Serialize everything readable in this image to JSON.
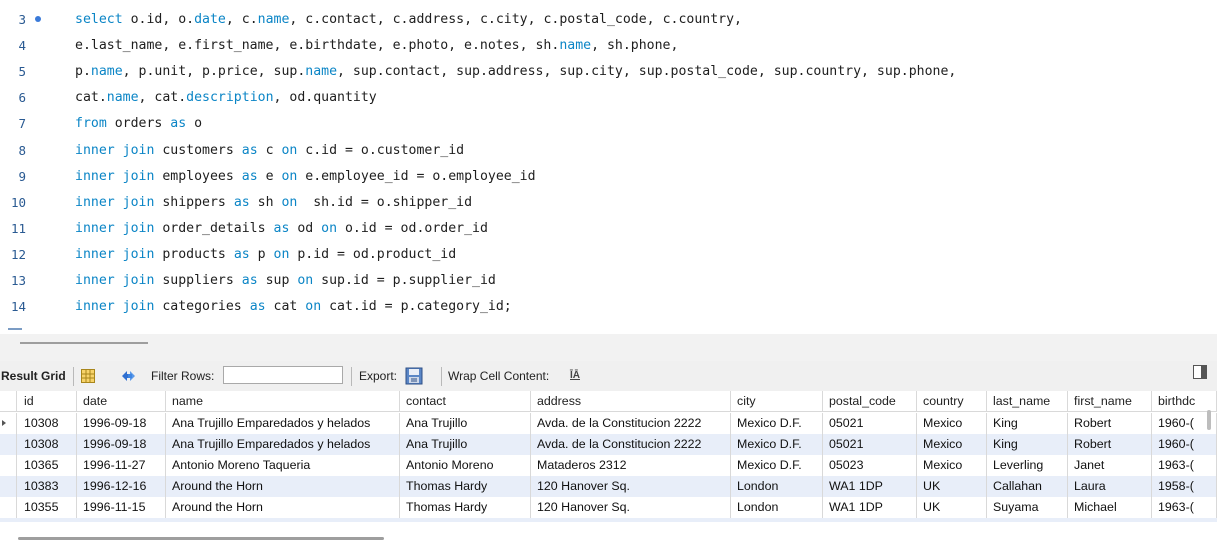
{
  "editor": {
    "lines": [
      {
        "num": "3",
        "has_dot": true,
        "tokens": [
          [
            "kw",
            "select "
          ],
          [
            "id",
            "o.id, o."
          ],
          [
            "kw",
            "date"
          ],
          [
            "id",
            ", c."
          ],
          [
            "kw",
            "name"
          ],
          [
            "id",
            ", c.contact, c.address, c.city, c.postal_code, c.country,"
          ]
        ]
      },
      {
        "num": "4",
        "has_dot": false,
        "tokens": [
          [
            "id",
            "e.last_name, e.first_name, e.birthdate, e.photo, e.notes, sh."
          ],
          [
            "kw",
            "name"
          ],
          [
            "id",
            ", sh.phone,"
          ]
        ]
      },
      {
        "num": "5",
        "has_dot": false,
        "tokens": [
          [
            "id",
            "p."
          ],
          [
            "kw",
            "name"
          ],
          [
            "id",
            ", p.unit, p.price, sup."
          ],
          [
            "kw",
            "name"
          ],
          [
            "id",
            ", sup.contact, sup.address, sup.city, sup.postal_code, sup.country, sup.phone,"
          ]
        ]
      },
      {
        "num": "6",
        "has_dot": false,
        "tokens": [
          [
            "id",
            "cat."
          ],
          [
            "kw",
            "name"
          ],
          [
            "id",
            ", cat."
          ],
          [
            "kw",
            "description"
          ],
          [
            "id",
            ", od.quantity"
          ]
        ]
      },
      {
        "num": "7",
        "has_dot": false,
        "tokens": [
          [
            "kw",
            "from "
          ],
          [
            "id",
            "orders "
          ],
          [
            "kw",
            "as "
          ],
          [
            "id",
            "o"
          ]
        ]
      },
      {
        "num": "8",
        "has_dot": false,
        "tokens": [
          [
            "kw",
            "inner join "
          ],
          [
            "id",
            "customers "
          ],
          [
            "kw",
            "as "
          ],
          [
            "id",
            "c "
          ],
          [
            "kw",
            "on "
          ],
          [
            "id",
            "c.id = o.customer_id"
          ]
        ]
      },
      {
        "num": "9",
        "has_dot": false,
        "tokens": [
          [
            "kw",
            "inner join "
          ],
          [
            "id",
            "employees "
          ],
          [
            "kw",
            "as "
          ],
          [
            "id",
            "e "
          ],
          [
            "kw",
            "on "
          ],
          [
            "id",
            "e.employee_id = o.employee_id"
          ]
        ]
      },
      {
        "num": "10",
        "has_dot": false,
        "tokens": [
          [
            "kw",
            "inner join "
          ],
          [
            "id",
            "shippers "
          ],
          [
            "kw",
            "as "
          ],
          [
            "id",
            "sh "
          ],
          [
            "kw",
            "on "
          ],
          [
            "id",
            " sh.id = o.shipper_id"
          ]
        ]
      },
      {
        "num": "11",
        "has_dot": false,
        "tokens": [
          [
            "kw",
            "inner join "
          ],
          [
            "id",
            "order_details "
          ],
          [
            "kw",
            "as "
          ],
          [
            "id",
            "od "
          ],
          [
            "kw",
            "on "
          ],
          [
            "id",
            "o.id = od.order_id"
          ]
        ]
      },
      {
        "num": "12",
        "has_dot": false,
        "tokens": [
          [
            "kw",
            "inner join "
          ],
          [
            "id",
            "products "
          ],
          [
            "kw",
            "as "
          ],
          [
            "id",
            "p "
          ],
          [
            "kw",
            "on "
          ],
          [
            "id",
            "p.id = od.product_id"
          ]
        ]
      },
      {
        "num": "13",
        "has_dot": false,
        "tokens": [
          [
            "kw",
            "inner join "
          ],
          [
            "id",
            "suppliers "
          ],
          [
            "kw",
            "as "
          ],
          [
            "id",
            "sup "
          ],
          [
            "kw",
            "on "
          ],
          [
            "id",
            "sup.id = p.supplier_id"
          ]
        ]
      },
      {
        "num": "14",
        "has_dot": false,
        "tokens": [
          [
            "kw",
            "inner join "
          ],
          [
            "id",
            "categories "
          ],
          [
            "kw",
            "as "
          ],
          [
            "id",
            "cat "
          ],
          [
            "kw",
            "on "
          ],
          [
            "id",
            "cat.id = p.category_id;"
          ]
        ]
      }
    ]
  },
  "toolbar": {
    "result_grid_label": "Result Grid",
    "filter_rows_label": "Filter Rows:",
    "filter_rows_value": "",
    "export_label": "Export:",
    "wrap_cell_label": "Wrap Cell Content:",
    "wrap_icon_glyph": "ĪĀ"
  },
  "grid": {
    "columns": [
      "id",
      "date",
      "name",
      "contact",
      "address",
      "city",
      "postal_code",
      "country",
      "last_name",
      "first_name",
      "birthdc"
    ],
    "rows": [
      [
        "10308",
        "1996-09-18",
        "Ana Trujillo Emparedados y helados",
        "Ana Trujillo",
        "Avda. de la Constitucion 2222",
        "Mexico D.F.",
        "05021",
        "Mexico",
        "King",
        "Robert",
        "1960-("
      ],
      [
        "10308",
        "1996-09-18",
        "Ana Trujillo Emparedados y helados",
        "Ana Trujillo",
        "Avda. de la Constitucion 2222",
        "Mexico D.F.",
        "05021",
        "Mexico",
        "King",
        "Robert",
        "1960-("
      ],
      [
        "10365",
        "1996-11-27",
        "Antonio Moreno Taqueria",
        "Antonio Moreno",
        "Mataderos 2312",
        "Mexico D.F.",
        "05023",
        "Mexico",
        "Leverling",
        "Janet",
        "1963-("
      ],
      [
        "10383",
        "1996-12-16",
        "Around the Horn",
        "Thomas Hardy",
        "120 Hanover Sq.",
        "London",
        "WA1 1DP",
        "UK",
        "Callahan",
        "Laura",
        "1958-("
      ],
      [
        "10355",
        "1996-11-15",
        "Around the Horn",
        "Thomas Hardy",
        "120 Hanover Sq.",
        "London",
        "WA1 1DP",
        "UK",
        "Suyama",
        "Michael",
        "1963-("
      ]
    ]
  },
  "colors": {
    "keyword": "#0b85c6",
    "line_number": "#2a5a92",
    "row_alt": "#e8eef9"
  }
}
